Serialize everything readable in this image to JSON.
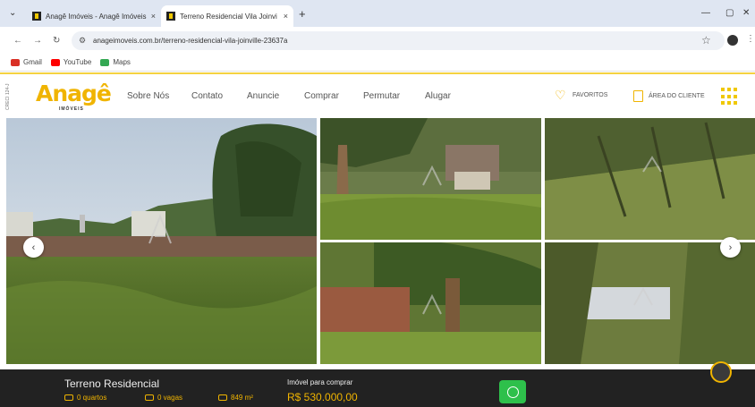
{
  "browser": {
    "tabs": [
      {
        "title": "Anagê Imóveis - Anagê Imóveis",
        "close": "×",
        "active": false
      },
      {
        "title": "Terreno Residencial Vila Joinvi",
        "close": "×",
        "active": true
      }
    ],
    "tab_list_icon": "chevron-down-icon",
    "new_tab": "+",
    "window_controls": {
      "minimize": "—",
      "restore": "▢",
      "close": "✕"
    },
    "nav": {
      "back": "←",
      "forward": "→",
      "reload": "↻"
    },
    "url": "anageimoveis.com.br/terreno-residencial-vila-joinville-23637a",
    "bookmark_star": "☆",
    "kebab": "⋮",
    "bookmarks": [
      {
        "label": "Gmail",
        "color": "#d93025"
      },
      {
        "label": "YouTube",
        "color": "#ff0000"
      },
      {
        "label": "Maps",
        "color": "#34a853"
      }
    ]
  },
  "site": {
    "vertical_tag": "CRECI 124-J",
    "logo": {
      "text": "Anagê",
      "sub": "IMÓVEIS"
    },
    "menu": [
      "Sobre Nós",
      "Contato",
      "Anuncie",
      "Comprar",
      "Permutar",
      "Alugar"
    ],
    "favorites_label": "FAVORITOS",
    "client_area_label": "ÁREA DO CLIENTE",
    "accent": "#f0b400"
  },
  "gallery": {
    "prev": "‹",
    "next": "›",
    "photo_count": 5
  },
  "footer": {
    "property_name": "Terreno Residencial",
    "features": [
      {
        "icon": "bed-icon",
        "label": "0 quartos"
      },
      {
        "icon": "car-icon",
        "label": "0 vagas"
      },
      {
        "icon": "area-icon",
        "label": "849 m²"
      }
    ],
    "mode": "Imóvel para comprar",
    "price": "R$ 530.000,00"
  }
}
